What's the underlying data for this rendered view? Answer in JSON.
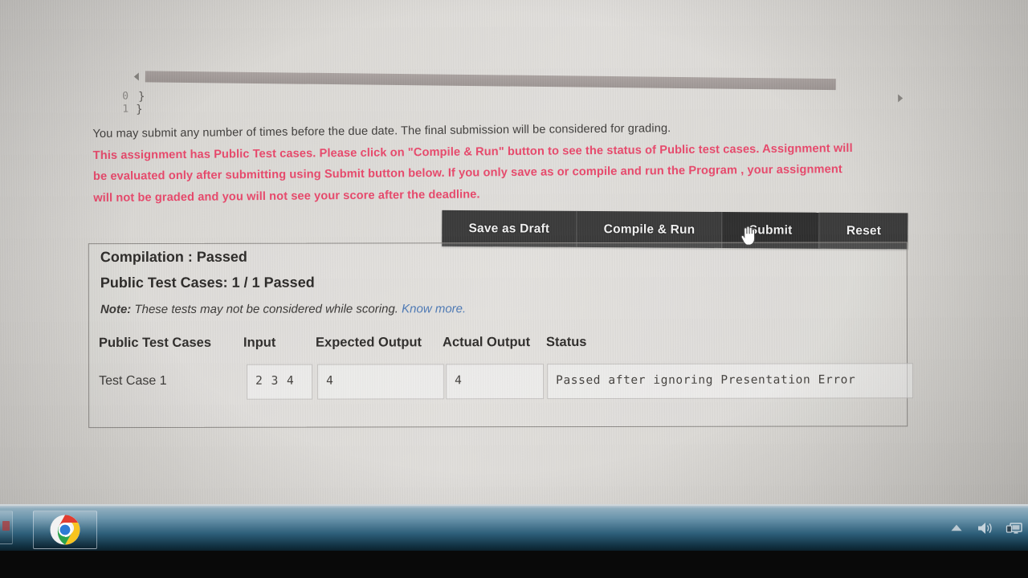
{
  "editor": {
    "line_numbers": [
      "0",
      "1"
    ],
    "code_lines": [
      "}",
      "}"
    ],
    "scroll_left_icon": "triangle-left-icon",
    "scroll_right_icon": "triangle-right-icon"
  },
  "instructions": {
    "plain": "You may submit any number of times before the due date. The final submission will be considered for grading.",
    "warning_lines": [
      "This assignment has Public Test cases. Please click on \"Compile & Run\" button to see the status of Public test cases. Assignment will",
      "be evaluated only after submitting using Submit button below. If you only save as or compile and run the Program , your assignment",
      "will not be graded and you will not see your score after the deadline."
    ],
    "warning_color": "#e8486b"
  },
  "actions": {
    "buttons": [
      {
        "label": "Save as Draft",
        "hovered": false
      },
      {
        "label": "Compile & Run",
        "hovered": false
      },
      {
        "label": "Submit",
        "hovered": true
      },
      {
        "label": "Reset",
        "hovered": false
      }
    ],
    "bar_color": "#3a3a3a",
    "hover_color": "#2e2e2e",
    "cursor": "hand-pointer-cursor"
  },
  "results": {
    "compilation_label": "Compilation : Passed",
    "public_test_summary": "Public Test Cases: 1 / 1 Passed",
    "note_prefix": "Note:",
    "note_text": " These tests may not be considered while scoring. ",
    "note_link": "Know more.",
    "link_color": "#4d79b5",
    "table": {
      "headers": [
        "Public Test Cases",
        "Input",
        "Expected Output",
        "Actual Output",
        "Status"
      ],
      "rows": [
        {
          "name": "Test Case 1",
          "input": "2 3 4",
          "expected_output": "4",
          "actual_output": "4",
          "status": "Passed after ignoring Presentation Error"
        }
      ]
    }
  },
  "taskbar": {
    "items": [
      {
        "name": "chrome",
        "label": "Google Chrome"
      }
    ],
    "tray": [
      {
        "name": "show-hidden-icons",
        "icon": "chevron-up-icon"
      },
      {
        "name": "volume",
        "icon": "speaker-icon"
      },
      {
        "name": "network",
        "icon": "monitor-icon"
      }
    ]
  }
}
